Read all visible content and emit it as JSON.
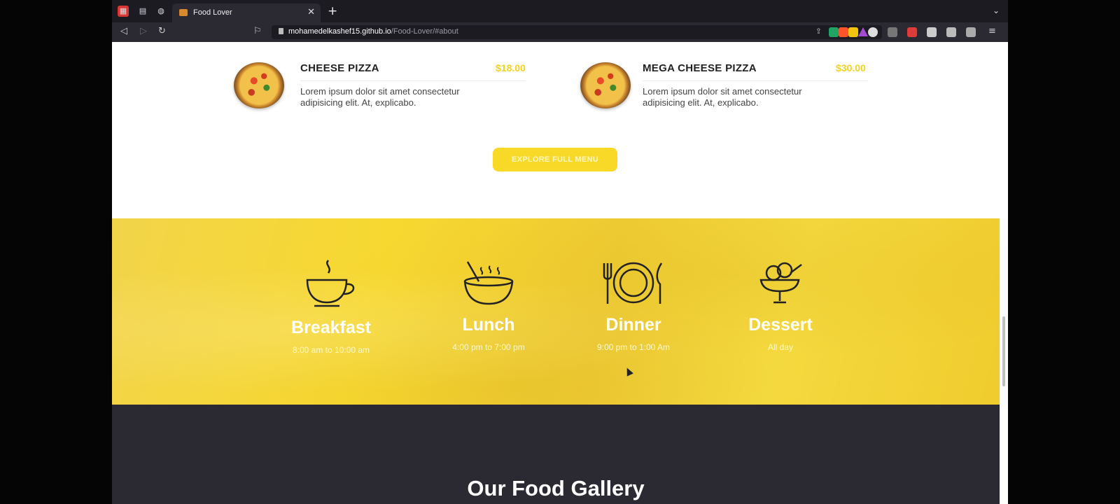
{
  "browser": {
    "tab_title": "Food Lover",
    "url_host": "mohamedelkashef15.github.io",
    "url_path": "/Food-Lover/#about"
  },
  "menu": {
    "items": [
      {
        "name": "CHEESE PIZZA",
        "price": "$18.00",
        "description": "Lorem ipsum dolor sit amet consectetur adipisicing elit. At, explicabo."
      },
      {
        "name": "MEGA CHEESE PIZZA",
        "price": "$30.00",
        "description": "Lorem ipsum dolor sit amet consectetur adipisicing elit. At, explicabo."
      }
    ],
    "explore_label": "EXPLORE FULL MENU"
  },
  "hours": {
    "meals": [
      {
        "title": "Breakfast",
        "time": "8:00 am to 10:00 am",
        "icon": "coffee-cup-icon"
      },
      {
        "title": "Lunch",
        "time": "4:00 pm to 7:00 pm",
        "icon": "soup-bowl-icon"
      },
      {
        "title": "Dinner",
        "time": "9:00 pm to 1:00 Am",
        "icon": "plate-cutlery-icon"
      },
      {
        "title": "Dessert",
        "time": "All day",
        "icon": "ice-cream-icon"
      }
    ]
  },
  "gallery": {
    "title": "Our Food Gallery"
  },
  "colors": {
    "accent": "#f8d928",
    "dark": "#2b2a33",
    "price": "#f5d21a"
  }
}
